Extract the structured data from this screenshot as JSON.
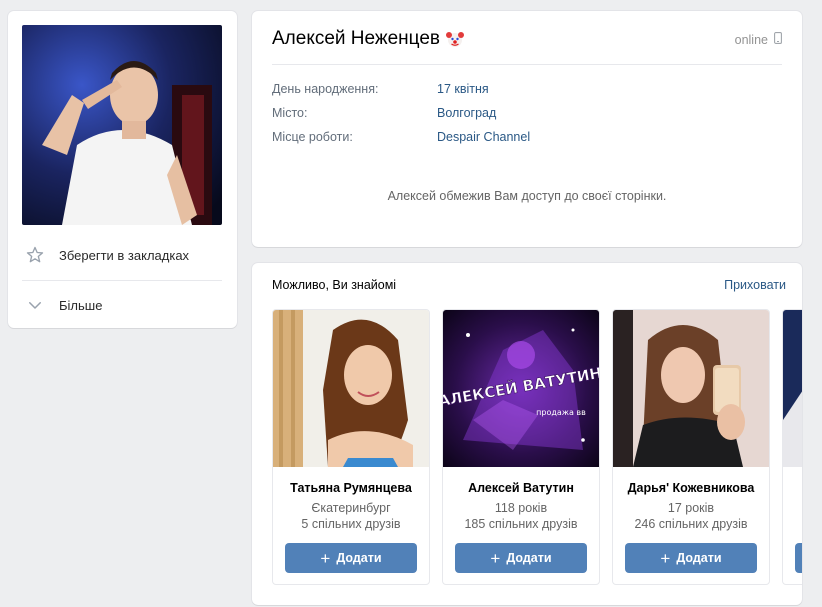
{
  "profile": {
    "name": "Алексей Неженцев",
    "emoji": "🤡",
    "online": "online",
    "details": [
      {
        "label": "День народження:",
        "value": "17 квітня"
      },
      {
        "label": "Місто:",
        "value": "Волгоград"
      },
      {
        "label": "Місце роботи:",
        "value": "Despair Channel"
      }
    ],
    "restricted_note": "Алексей обмежив Вам доступ до своєї сторінки."
  },
  "left_menu": {
    "bookmark_label": "Зберегти в закладках",
    "bookmark_icon": "star-icon",
    "more_label": "Більше",
    "more_icon": "chevron-down-icon"
  },
  "suggestions": {
    "title": "Можливо, Ви знайомі",
    "hide_label": "Приховати",
    "items": [
      {
        "name": "Татьяна Румянцева",
        "line1": "Єкатеринбург",
        "line2": "5 спільних друзів",
        "add_label": "Додати"
      },
      {
        "name": "Алексей Ватутин",
        "line1": "118 років",
        "line2": "185 спільних друзів",
        "add_label": "Додати",
        "photo_text": "АЛЕКСЕЙ ВАТУТИН",
        "photo_subtext": "продажа вв"
      },
      {
        "name": "Дарья' Кожевникова",
        "line1": "17 років",
        "line2": "246 спільних друзів",
        "add_label": "Додати"
      },
      {
        "name": "",
        "line1": "",
        "line2": "",
        "add_label": ""
      }
    ]
  },
  "colors": {
    "link": "#2a5885",
    "button": "#5181b8",
    "background": "#edeef0"
  }
}
